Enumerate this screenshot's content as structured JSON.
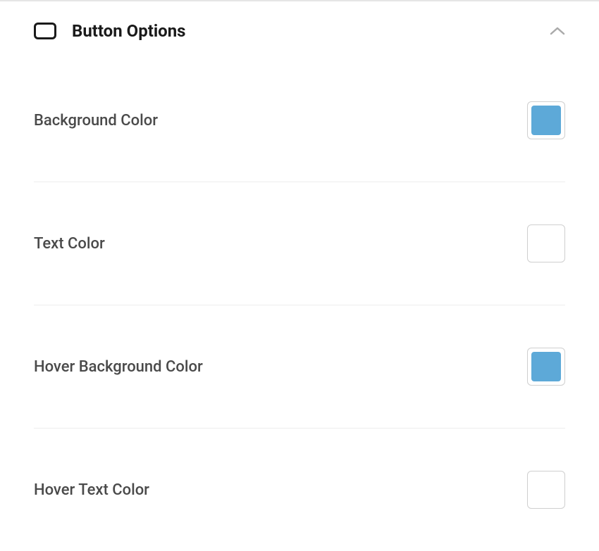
{
  "section": {
    "title": "Button Options",
    "expanded": true
  },
  "options": [
    {
      "label": "Background Color",
      "color": "#5da9d8",
      "hasColor": true,
      "name": "background-color"
    },
    {
      "label": "Text Color",
      "color": "#ffffff",
      "hasColor": false,
      "name": "text-color"
    },
    {
      "label": "Hover Background Color",
      "color": "#5da9d8",
      "hasColor": true,
      "name": "hover-background-color"
    },
    {
      "label": "Hover Text Color",
      "color": "#ffffff",
      "hasColor": false,
      "name": "hover-text-color"
    }
  ]
}
